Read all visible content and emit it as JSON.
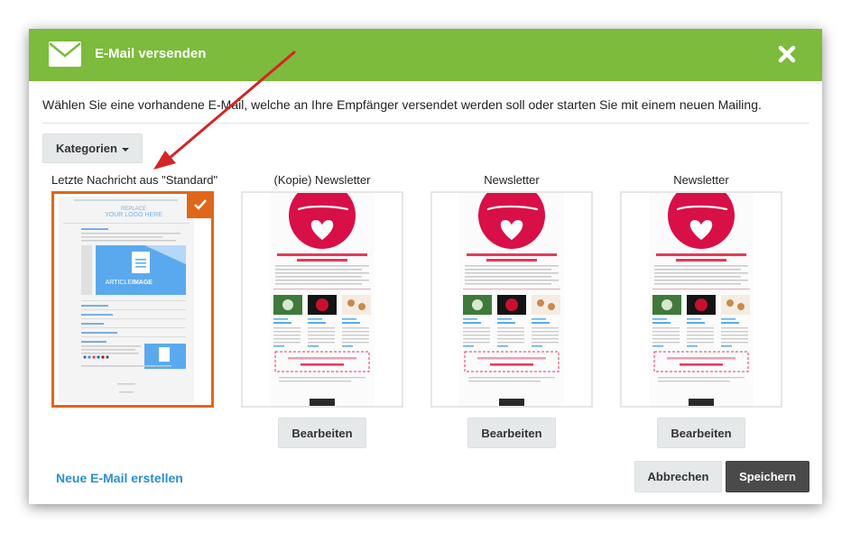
{
  "dialog": {
    "title": "E-Mail versenden",
    "intro": "Wählen Sie eine vorhandene E-Mail, welche an Ihre Empfänger versendet werden soll oder starten Sie mit einem neuen Mailing.",
    "categories_label": "Kategorien",
    "header_color": "#7cbb3c",
    "selected_color": "#e0661b"
  },
  "templates": [
    {
      "title": "Letzte Nachricht aus \"Standard\"",
      "selected": true
    },
    {
      "title": "(Kopie) Newsletter",
      "edit_label": "Bearbeiten"
    },
    {
      "title": "Newsletter",
      "edit_label": "Bearbeiten"
    },
    {
      "title": "Newsletter",
      "edit_label": "Bearbeiten"
    }
  ],
  "preview_standard": {
    "logo_line1": "REPLACE",
    "logo_line2": "YOUR LOGO HERE",
    "image_label_a": "ARTICLE",
    "image_label_b": "IMAGE"
  },
  "footer": {
    "new_email_link": "Neue E-Mail erstellen",
    "cancel_label": "Abbrechen",
    "save_label": "Speichern"
  }
}
